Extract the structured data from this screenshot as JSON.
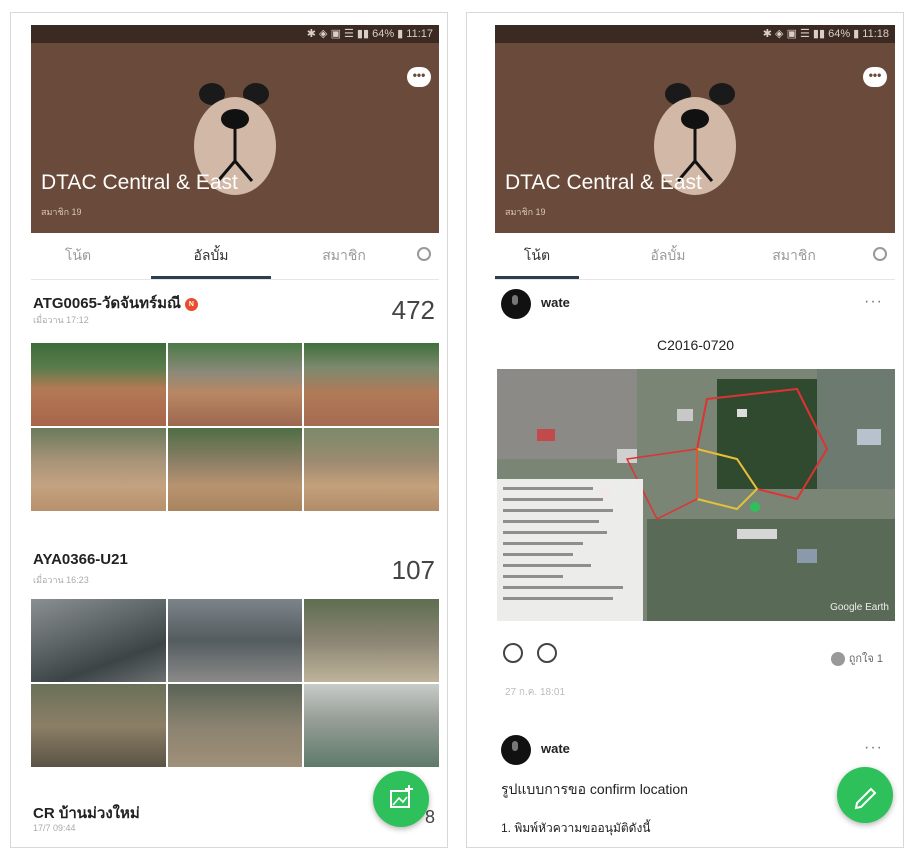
{
  "left": {
    "status_text": "✱ ◈ ▣ ☰ ▮▮ 64% ▮ 11:17",
    "group_title": "DTAC Central & East",
    "member_count": "สมาชิก 19",
    "tabs": [
      "โน้ต",
      "อัลบั้ม",
      "สมาชิก"
    ],
    "active_tab": 1,
    "albums": [
      {
        "name": "ATG0065-วัดจันทร์มณี",
        "badge": "N",
        "time": "เมื่อวาน 17:12",
        "count": "472"
      },
      {
        "name": "AYA0366-U21",
        "time": "เมื่อวาน 16:23",
        "count": "107"
      },
      {
        "name": "CR บ้านม่วงใหม่",
        "time": "17/7 09:44",
        "count": "8"
      }
    ],
    "fab_icon": "add-photo-icon"
  },
  "right": {
    "status_text": "✱ ◈ ▣ ☰ ▮▮ 64% ▮ 11:18",
    "group_title": "DTAC Central & East",
    "member_count": "สมาชิก 19",
    "tabs": [
      "โน้ต",
      "อัลบั้ม",
      "สมาชิก"
    ],
    "active_tab": 0,
    "posts": [
      {
        "author": "wate",
        "title": "C2016-0720",
        "map_credit": "Google Earth",
        "like_text": "ถูกใจ 1",
        "time": "27 ก.ค. 18:01"
      },
      {
        "author": "wate",
        "heading": "รูปแบบการขอ confirm location",
        "line1": "1. พิมพ์หัวความขออนุมัติดังนี้"
      }
    ],
    "fab_icon": "pencil-icon"
  },
  "colors": {
    "cover": "#6a4a3a",
    "fab": "#2ec05a",
    "badge": "#e94d2b"
  }
}
